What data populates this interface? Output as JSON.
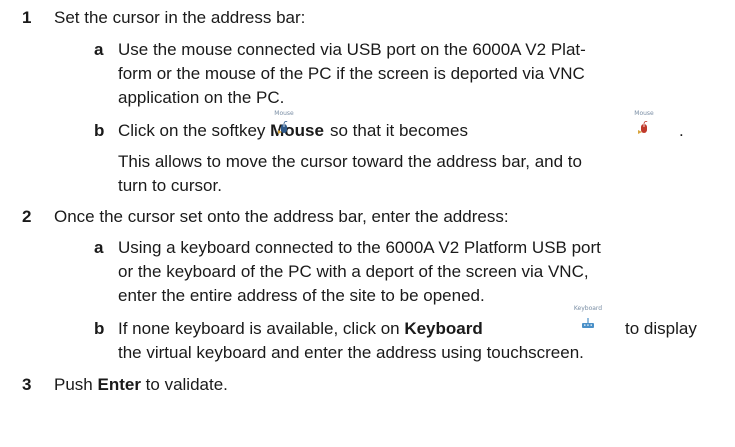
{
  "steps": [
    {
      "number": "1",
      "text": "Set the cursor in the address bar:",
      "substeps": [
        {
          "letter": "a",
          "lines": [
            "Use the mouse connected via USB port on the 6000A V2 Plat-",
            "form or the mouse of the PC if the screen is deported via VNC",
            "application on the PC."
          ]
        },
        {
          "letter": "b",
          "pre": "Click on the softkey ",
          "bold": "Mouse",
          "post": "so that it becomes",
          "end": ".",
          "note_lines": [
            "This allows to move the cursor toward the address bar, and to",
            "turn to cursor."
          ]
        }
      ]
    },
    {
      "number": "2",
      "text": "Once the cursor set onto the address bar, enter the address:",
      "substeps": [
        {
          "letter": "a",
          "lines": [
            "Using a keyboard connected to the 6000A V2 Platform USB port",
            "or the keyboard of the PC with a deport of the screen via VNC,",
            "enter the entire address of the site to be opened."
          ]
        },
        {
          "letter": "b",
          "pre": "If none keyboard is available, click on ",
          "bold": "Keyboard",
          "post": "to display",
          "line2": "the virtual keyboard and enter the address using touchscreen."
        }
      ]
    },
    {
      "number": "3",
      "pre": "Push ",
      "bold": "Enter",
      "post": " to validate."
    }
  ],
  "softkeys": {
    "mouse_off": {
      "caption": "Mouse",
      "icon": "mouse-icon",
      "color": "#2f5a8a"
    },
    "mouse_on": {
      "caption": "Mouse",
      "icon": "mouse-icon",
      "color": "#c0392b"
    },
    "keyboard": {
      "caption": "Keyboard",
      "icon": "keyboard-icon",
      "color": "#4a90c8"
    }
  }
}
